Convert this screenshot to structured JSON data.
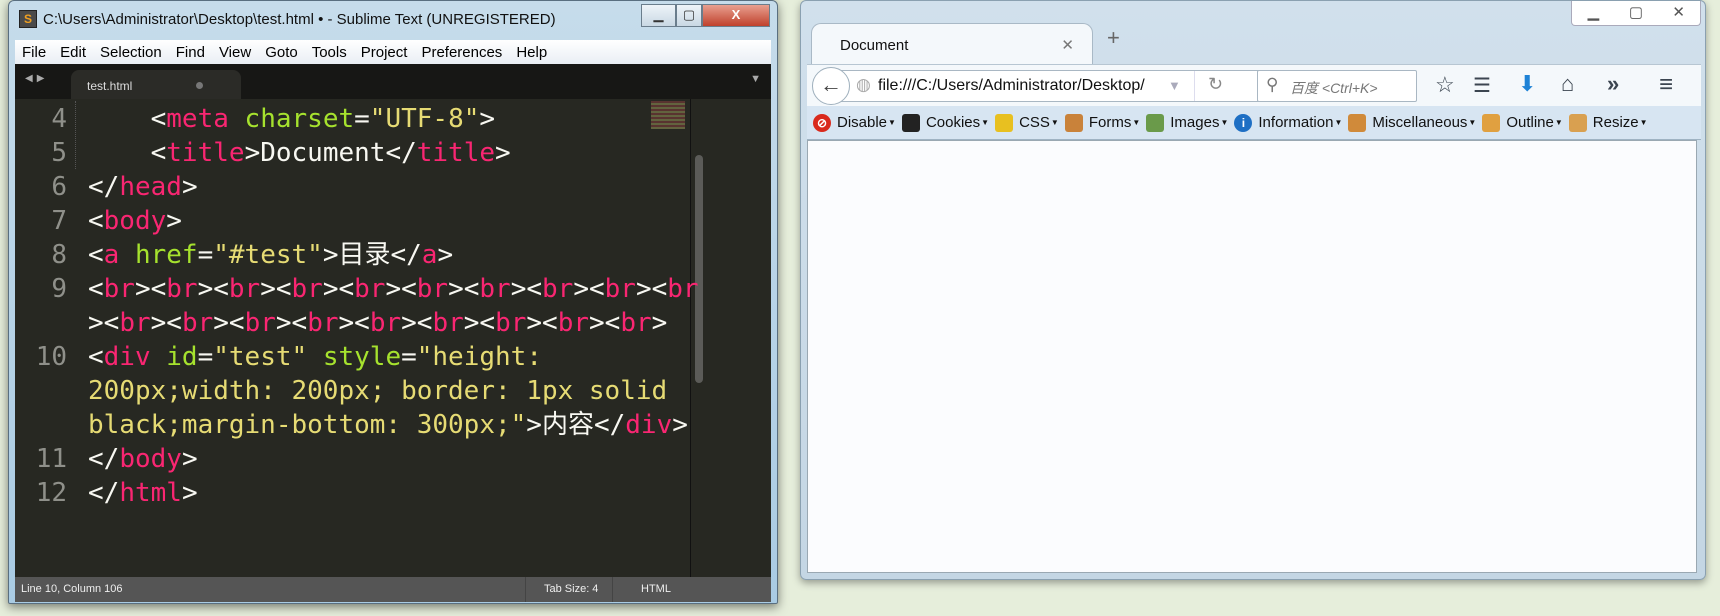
{
  "sublime": {
    "title": "C:\\Users\\Administrator\\Desktop\\test.html • - Sublime Text (UNREGISTERED)",
    "menu": [
      "File",
      "Edit",
      "Selection",
      "Find",
      "View",
      "Goto",
      "Tools",
      "Project",
      "Preferences",
      "Help"
    ],
    "tab": "test.html",
    "lines": [
      {
        "num": "4",
        "parts": [
          [
            "",
            "    <"
          ],
          [
            "t",
            "meta"
          ],
          [
            "a",
            " charset"
          ],
          [
            "",
            "="
          ],
          [
            "s",
            "\"UTF-8\""
          ],
          [
            "",
            ">"
          ]
        ]
      },
      {
        "num": "5",
        "parts": [
          [
            "",
            "    <"
          ],
          [
            "t",
            "title"
          ],
          [
            "",
            ">Document</"
          ],
          [
            "t",
            "title"
          ],
          [
            "",
            ">"
          ]
        ]
      },
      {
        "num": "6",
        "parts": [
          [
            "",
            "</"
          ],
          [
            "t",
            "head"
          ],
          [
            "",
            ">"
          ]
        ]
      },
      {
        "num": "7",
        "parts": [
          [
            "",
            "<"
          ],
          [
            "t",
            "body"
          ],
          [
            "",
            ">"
          ]
        ]
      },
      {
        "num": "8",
        "parts": [
          [
            "",
            "<"
          ],
          [
            "t",
            "a"
          ],
          [
            "a",
            " href"
          ],
          [
            "",
            "="
          ],
          [
            "s",
            "\"#test\""
          ],
          [
            "",
            ">目录</"
          ],
          [
            "t",
            "a"
          ],
          [
            "",
            ">"
          ]
        ]
      },
      {
        "num": "9",
        "parts": [
          [
            "",
            "<"
          ],
          [
            "t",
            "br"
          ],
          [
            "",
            "><"
          ],
          [
            "t",
            "br"
          ],
          [
            "",
            "><"
          ],
          [
            "t",
            "br"
          ],
          [
            "",
            "><"
          ],
          [
            "t",
            "br"
          ],
          [
            "",
            "><"
          ],
          [
            "t",
            "br"
          ],
          [
            "",
            "><"
          ],
          [
            "t",
            "br"
          ],
          [
            "",
            "><"
          ],
          [
            "t",
            "br"
          ],
          [
            "",
            "><"
          ],
          [
            "t",
            "br"
          ],
          [
            "",
            "><"
          ],
          [
            "t",
            "br"
          ],
          [
            "",
            "><"
          ],
          [
            "t",
            "br"
          ]
        ]
      },
      {
        "num": "",
        "parts": [
          [
            "",
            "><"
          ],
          [
            "t",
            "br"
          ],
          [
            "",
            "><"
          ],
          [
            "t",
            "br"
          ],
          [
            "",
            "><"
          ],
          [
            "t",
            "br"
          ],
          [
            "",
            "><"
          ],
          [
            "t",
            "br"
          ],
          [
            "",
            "><"
          ],
          [
            "t",
            "br"
          ],
          [
            "",
            "><"
          ],
          [
            "t",
            "br"
          ],
          [
            "",
            "><"
          ],
          [
            "t",
            "br"
          ],
          [
            "",
            "><"
          ],
          [
            "t",
            "br"
          ],
          [
            "",
            "><"
          ],
          [
            "t",
            "br"
          ],
          [
            "",
            ">"
          ]
        ]
      },
      {
        "num": "10",
        "parts": [
          [
            "",
            "<"
          ],
          [
            "t",
            "div"
          ],
          [
            "a",
            " id"
          ],
          [
            "",
            "="
          ],
          [
            "s",
            "\"test\""
          ],
          [
            "a",
            " style"
          ],
          [
            "",
            "="
          ],
          [
            "s",
            "\"height:"
          ]
        ]
      },
      {
        "num": "",
        "parts": [
          [
            "s",
            "200px;width: 200px; border: 1px solid"
          ]
        ]
      },
      {
        "num": "",
        "parts": [
          [
            "s",
            "black;margin-bottom: 300px;\""
          ],
          [
            "",
            ">内容</"
          ],
          [
            "t",
            "div"
          ],
          [
            "",
            ">"
          ]
        ]
      },
      {
        "num": "11",
        "parts": [
          [
            "",
            "</"
          ],
          [
            "t",
            "body"
          ],
          [
            "",
            ">"
          ]
        ]
      },
      {
        "num": "12",
        "parts": [
          [
            "",
            "</"
          ],
          [
            "t",
            "html"
          ],
          [
            "",
            ">"
          ]
        ]
      }
    ],
    "status": {
      "position": "Line 10, Column 106",
      "tab_size": "Tab Size: 4",
      "syntax": "HTML"
    }
  },
  "firefox": {
    "tab_title": "Document",
    "url": "file:///C:/Users/Administrator/Desktop/",
    "search_placeholder": "百度 <Ctrl+K>",
    "bookmarks": [
      {
        "label": "Disable",
        "icon": "disable-icon",
        "color": "#d9291c"
      },
      {
        "label": "Cookies",
        "icon": "cookies-icon",
        "color": "#222222"
      },
      {
        "label": "CSS",
        "icon": "css-wand-icon",
        "color": "#e8c020"
      },
      {
        "label": "Forms",
        "icon": "forms-clipboard-icon",
        "color": "#c9823a"
      },
      {
        "label": "Images",
        "icon": "images-icon",
        "color": "#6a9a4a"
      },
      {
        "label": "Information",
        "icon": "information-icon",
        "color": "#1e6fc4"
      },
      {
        "label": "Miscellaneous",
        "icon": "miscellaneous-icon",
        "color": "#d08a3a"
      },
      {
        "label": "Outline",
        "icon": "outline-pencil-icon",
        "color": "#e0a040"
      },
      {
        "label": "Resize",
        "icon": "resize-ruler-icon",
        "color": "#d9a050"
      }
    ]
  }
}
